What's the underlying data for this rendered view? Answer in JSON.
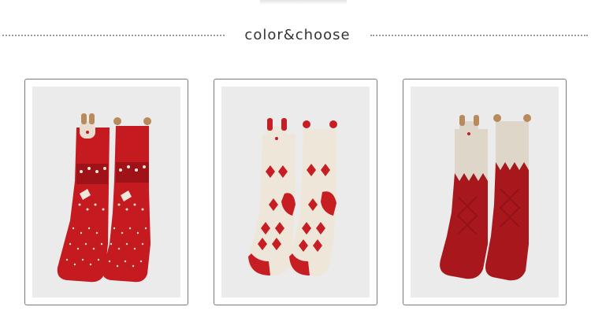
{
  "header": {
    "title": "color&choose"
  },
  "products": [
    {
      "name": "red-reindeer-socks",
      "colors": {
        "sock": "#c41a20",
        "trim": "#e9ddd0",
        "ears": "#b88a5c"
      }
    },
    {
      "name": "cream-reindeer-socks",
      "colors": {
        "sock": "#efe6da",
        "trim": "#c71e24",
        "ears": "#c71e24"
      }
    },
    {
      "name": "burgundy-reindeer-socks",
      "colors": {
        "sock": "#a8171b",
        "trim": "#ded6c9",
        "ears": "#b88a5c"
      }
    }
  ]
}
